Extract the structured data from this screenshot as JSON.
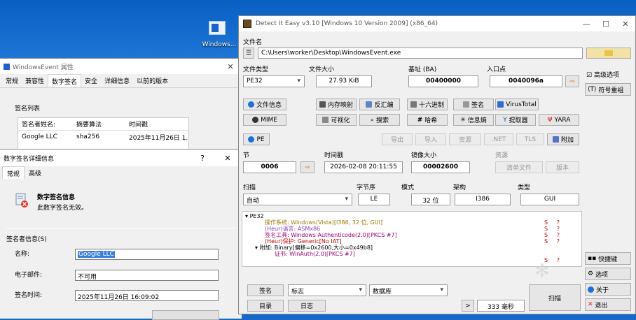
{
  "desktop": {
    "icon_label": "Windows..."
  },
  "props": {
    "title": "WindowsEvent 属性",
    "tabs": [
      "常规",
      "兼容性",
      "数字签名",
      "安全",
      "详细信息",
      "以前的版本"
    ],
    "group_label": "签名列表",
    "columns": [
      "签名者姓名:",
      "摘要算法",
      "时间戳"
    ],
    "rows": [
      [
        "Google LLC",
        "sha256",
        "2025年11月26日 1..."
      ]
    ]
  },
  "details": {
    "title": "数字签名详细信息",
    "help": "?",
    "close": "✕",
    "tabs": [
      "常规",
      "高级"
    ],
    "info_title": "数字签名信息",
    "info_text": "此数字签名无效。",
    "signer_group": "签名者信息(S)",
    "name_label": "名称:",
    "name_value": "Google LLC",
    "email_label": "电子邮件:",
    "email_value": "不可用",
    "time_label": "签名时间:",
    "time_value": "2025年11月26日 16:09:02"
  },
  "die": {
    "title": "Detect It Easy v3.10 [Windows 10 Version 2009] (x86_64)",
    "file_label": "文件名",
    "file_path": "C:\\Users\\worker\\Desktop\\WindowsEvent.exe",
    "filetype_label": "文件类型",
    "filetype_value": "PE32",
    "filesize_label": "文件大小",
    "filesize_value": "27.93 KiB",
    "base_label": "基址 (BA)",
    "base_value": "00400000",
    "entry_label": "入口点",
    "entry_value": "0040096a",
    "advanced": "高级选项",
    "symbols": "符号重组",
    "buttons_row1": [
      "文件信息",
      "内存映射",
      "反汇编",
      "十六进制",
      "签名",
      "VirusTotal"
    ],
    "buttons_row2": [
      "MIME",
      "可视化",
      "搜索",
      "哈希",
      "信息熵",
      "提取器",
      "YARA"
    ],
    "pe_button": "PE",
    "buttons_row3": [
      "导出",
      "导入",
      "资源",
      ".NET",
      "TLS",
      "附加"
    ],
    "section_label": "节",
    "section_value": "0006",
    "timestamp_label": "时间戳",
    "timestamp_value": "2026-02-08 20:11:55",
    "imagesize_label": "镜像大小",
    "imagesize_value": "00002600",
    "resource_label": "资源",
    "manifest": "清单文件",
    "version": "版本",
    "scan_label": "扫描",
    "scan_mode": "自动",
    "endian_label": "字节序",
    "endian_value": "LE",
    "mode_label": "模式",
    "mode_value": "32 位",
    "arch_label": "架构",
    "arch_value": "I386",
    "type_label": "类型",
    "type_value": "GUI",
    "tree": {
      "root": "PE32",
      "lines": [
        {
          "text": "操作系统: Windows(Vista)[I386, 32 位, GUI]",
          "color": "#9b7a00",
          "s": "S",
          "q": "?"
        },
        {
          "text": "(Heur)语言: ASMx86",
          "color": "#8a3fb0",
          "s": "S",
          "q": "?"
        },
        {
          "text": "签名工具: Windows Authenticode(2.0)[PKCS #7]",
          "color": "#a0007a",
          "s": "S",
          "q": "?"
        },
        {
          "text": "(Heur)保护: Generic[No IAT]",
          "color": "#c00000",
          "s": "S",
          "q": "?"
        },
        {
          "text": "附加: Binary[偏移=0x2600,大小=0x49b8]",
          "color": "#000000"
        },
        {
          "text": "证书: WinAuth(2.0)[PKCS #7]",
          "color": "#a0007a",
          "s": "S",
          "q": "?"
        }
      ]
    },
    "sign_btn": "签名",
    "flag_select": "标志",
    "db_select": "数据库",
    "dir_btn": "目录",
    "log_btn": "日志",
    "more_btn": ">",
    "time_ms": "333 毫秒",
    "scan_btn": "扫描",
    "shortcuts": "快捷键",
    "options": "选项",
    "about": "关于",
    "exit": "退出"
  },
  "colors": {
    "accent": "#1e6fd9"
  }
}
